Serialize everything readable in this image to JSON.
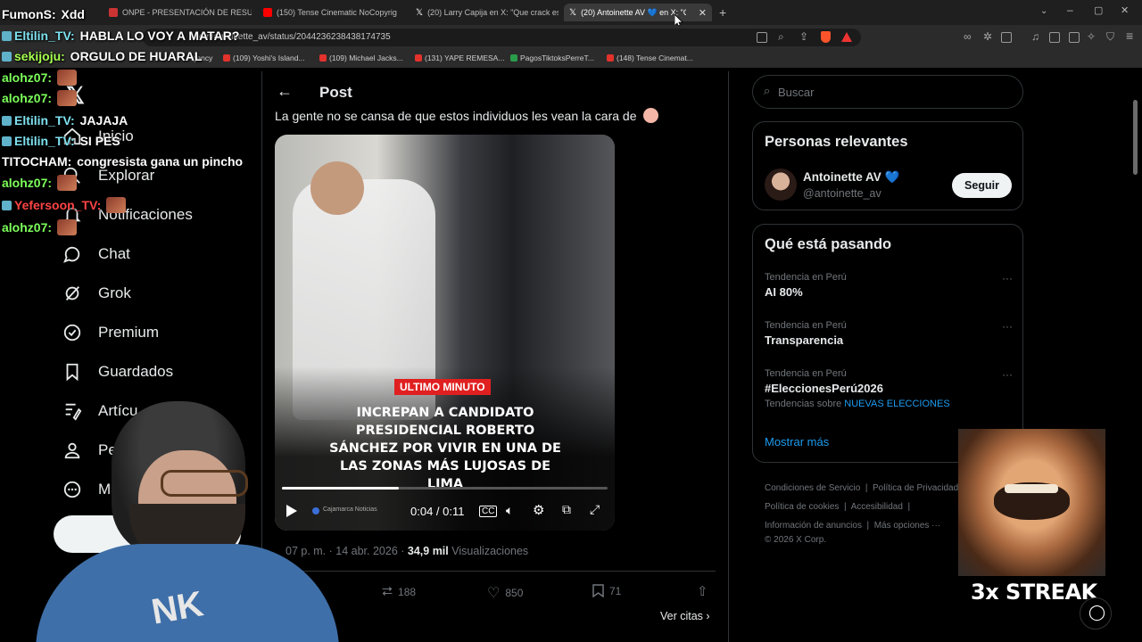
{
  "browser": {
    "tabs": [
      {
        "label": "ONPE - PRESENTACIÓN DE RESULTA",
        "active": false
      },
      {
        "label": "(150) Tense Cinematic NoCopyrig",
        "active": false
      },
      {
        "label": "(20) Larry Capija en X: \"Que crack es",
        "active": false
      },
      {
        "label": "(20) Antoinette AV 💙 en X: \"Qu",
        "active": true
      }
    ],
    "url": "com/antoinette_av/status/2044236238438174735",
    "bookmarks": [
      "Agency",
      "(109) Yoshi's Island...",
      "(109) Michael Jacks...",
      "(131) YAPE REMESA...",
      "PagosTiktoksPerreT...",
      "(148) Tense Cinemat..."
    ]
  },
  "chat": [
    {
      "user": "FumonS:",
      "text": " Xdd",
      "color": "#ffffff",
      "badge": false
    },
    {
      "user": "Eltilin_TV:",
      "text": " HABLA LO VOY A MATAR?",
      "color": "#7ee1ef",
      "badge": true
    },
    {
      "user": "sekijoju:",
      "text": " ORGULO DE HUARAL",
      "color": "#a6ff4f",
      "badge": true
    },
    {
      "user": "alohz07:",
      "text": "",
      "color": "#7cff5a",
      "badge": false,
      "emote": true
    },
    {
      "user": "alohz07:",
      "text": "",
      "color": "#7cff5a",
      "badge": false,
      "emote": true
    },
    {
      "user": "Eltilin_TV:",
      "text": " JAJAJA",
      "color": "#7ee1ef",
      "badge": true
    },
    {
      "user": "Eltilin_TV:",
      "text": " SI PES",
      "color": "#7ee1ef",
      "badge": true
    },
    {
      "user": "TITOCHAM:",
      "text": " congresista gana un pincho",
      "color": "#ffffff",
      "badge": false
    },
    {
      "user": "alohz07:",
      "text": "",
      "color": "#7cff5a",
      "badge": false,
      "emote": true
    },
    {
      "user": "Yefersoon_TV:",
      "text": "",
      "color": "#ff4444",
      "badge": true,
      "emote": true
    },
    {
      "user": "alohz07:",
      "text": "",
      "color": "#7cff5a",
      "badge": false,
      "emote": true
    }
  ],
  "nav": {
    "items": [
      "Inicio",
      "Explorar",
      "Notificaciones",
      "Chat",
      "Grok",
      "Premium",
      "Guardados",
      "Artícu",
      "Pe",
      "Ma"
    ]
  },
  "post": {
    "header_title": "Post",
    "text": "La gente no se cansa de que estos individuos les vean la cara de",
    "video": {
      "badge": "ULTIMO MINUTO",
      "headline": "INCREPAN A CANDIDATO PRESIDENCIAL ROBERTO SÁNCHEZ POR VIVIR EN UNA DE LAS ZONAS MÁS LUJOSAS DE LIMA",
      "channel": "Cajamarca Noticias",
      "time": "0:04 / 0:11",
      "progress": 0.36
    },
    "meta_time": "07 p. m. · 14 abr. 2026 · ",
    "views_count": "34,9 mil",
    "views_label": " Visualizaciones",
    "reposts": "188",
    "likes": "850",
    "bookmarks": "71",
    "quotes_link": "Ver citas"
  },
  "sidebar": {
    "search_placeholder": "Buscar",
    "relevant_title": "Personas relevantes",
    "person_name": "Antoinette AV 💙",
    "person_handle": "@antoinette_av",
    "follow_label": "Seguir",
    "trends_title": "Qué está pasando",
    "trends": [
      {
        "context": "Tendencia en Perú",
        "name": "AI 80%"
      },
      {
        "context": "Tendencia en Perú",
        "name": "Transparencia"
      },
      {
        "context": "Tendencia en Perú",
        "name": "#EleccionesPerú2026",
        "extra_prefix": "Tendencias sobre ",
        "extra_link": "NUEVAS ELECCIONES"
      }
    ],
    "show_more": "Mostrar más",
    "footer_links": [
      "Condiciones de Servicio",
      "Política de Privacidad",
      "Política de cookies",
      "Accesibilidad",
      "Información de anuncios",
      "Más opciones ···"
    ],
    "copyright": "© 2026 X Corp."
  },
  "overlay": {
    "streak": "3x STREAK"
  }
}
